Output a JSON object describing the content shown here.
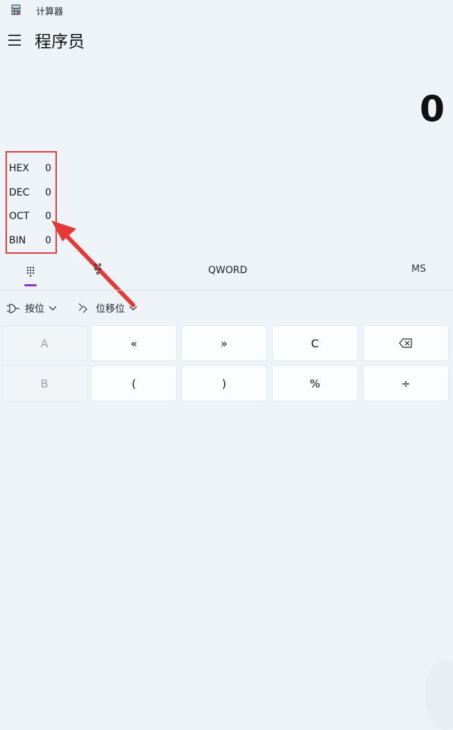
{
  "window": {
    "title": "计算器",
    "icon": "calculator-icon"
  },
  "header": {
    "menu_icon": "hamburger-icon",
    "mode_title": "程序员"
  },
  "display": {
    "value": "0"
  },
  "radix": [
    {
      "label": "HEX",
      "value": "0"
    },
    {
      "label": "DEC",
      "value": "0"
    },
    {
      "label": "OCT",
      "value": "0"
    },
    {
      "label": "BIN",
      "value": "0"
    }
  ],
  "tabs": {
    "keypad_icon": "keypad-icon",
    "bit_toggle_icon": "bit-toggle-icon",
    "word_size": "QWORD",
    "memory": "MS"
  },
  "operators": {
    "bitwise_label": "按位",
    "bitshift_label": "位移位"
  },
  "keys": {
    "row1": [
      "A",
      "«",
      "»",
      "C",
      "backspace"
    ],
    "row2": [
      "B",
      "(",
      ")",
      "%",
      "÷"
    ]
  },
  "colors": {
    "accent": "#8a2be2",
    "highlight": "#e53935"
  }
}
